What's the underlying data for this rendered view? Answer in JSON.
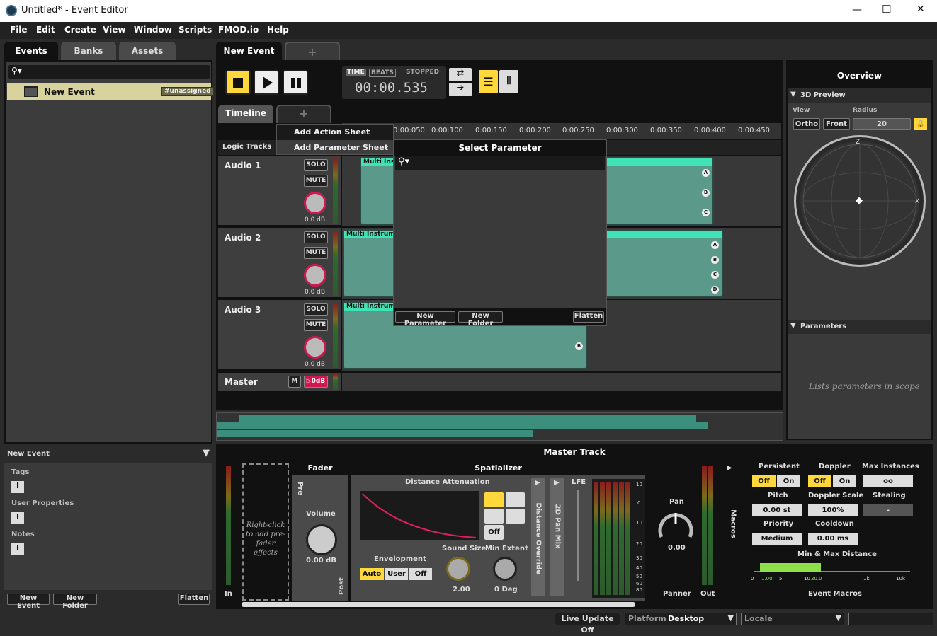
{
  "window": {
    "title": "Untitled* - Event Editor",
    "minimize": "—",
    "maximize": "☐",
    "close": "✕"
  },
  "menu": [
    "File",
    "Edit",
    "Create",
    "View",
    "Window",
    "Scripts",
    "FMOD.io",
    "Help"
  ],
  "browser": {
    "tabs": [
      "Events",
      "Banks",
      "Assets"
    ],
    "items": [
      {
        "label": "New Event",
        "tag": "#unassigned"
      }
    ],
    "footer": {
      "new_event": "New Event",
      "new_folder": "New Folder",
      "flatten": "Flatten"
    },
    "details": {
      "title": "New Event",
      "tags": "Tags",
      "user_properties": "User Properties",
      "notes": "Notes"
    }
  },
  "editor": {
    "event_tab": "New Event",
    "add_tab": "+",
    "transport": {
      "time_label": "TIME",
      "beats_label": "BEATS",
      "state": "STOPPED",
      "time": "00:00.535"
    },
    "timeline_tab": "Timeline",
    "logic_tracks": "Logic Tracks",
    "ruler": [
      "0:00:050",
      "0:00:100",
      "0:00:150",
      "0:00:200",
      "0:00:250",
      "0:00:300",
      "0:00:350",
      "0:00:400",
      "0:00:450"
    ],
    "tracks": [
      {
        "name": "Audio 1",
        "solo": "SOLO",
        "mute": "MUTE",
        "db": "0.0 dB",
        "region": "Multi Ins",
        "markers": [
          "A",
          "B",
          "C"
        ]
      },
      {
        "name": "Audio 2",
        "solo": "SOLO",
        "mute": "MUTE",
        "db": "0.0 dB",
        "region": "Multi Instrum",
        "markers": [
          "A",
          "B",
          "C",
          "D"
        ]
      },
      {
        "name": "Audio 3",
        "solo": "SOLO",
        "mute": "MUTE",
        "db": "0.0 dB",
        "region": "Multi Instrum",
        "markers": [
          "B"
        ]
      }
    ],
    "master": {
      "name": "Master",
      "m": "M",
      "db": "0dB"
    }
  },
  "context_menu": {
    "items": [
      "Add Action Sheet",
      "Add Parameter Sheet"
    ],
    "submenu_arrow": "›"
  },
  "select_parameter": {
    "title": "Select Parameter",
    "new_parameter": "New Parameter",
    "new_folder": "New Folder",
    "flatten": "Flatten"
  },
  "overview": {
    "title": "Overview",
    "preview_section": "3D Preview",
    "view_label": "View",
    "radius_label": "Radius",
    "ortho": "Ortho",
    "front": "Front",
    "radius": "20",
    "axis_z": "Z",
    "axis_x": "X",
    "parameters_section": "Parameters",
    "empty_text": "Lists parameters in scope"
  },
  "deck": {
    "title": "Master Track",
    "in": "In",
    "out": "Out",
    "prefader_hint": "Right-click to add pre-fader effects",
    "fader": {
      "title": "Fader",
      "pre": "Pre",
      "post": "Post",
      "volume": "Volume",
      "value": "0.00 dB"
    },
    "spatializer": {
      "title": "Spatializer",
      "distance_attenuation": "Distance Attenuation",
      "off": "Off",
      "envelopment": "Envelopment",
      "env_options": [
        "Auto",
        "User",
        "Off"
      ],
      "sound_size": "Sound Size",
      "sound_size_value": "2.00",
      "min_extent": "Min Extent",
      "min_extent_value": "0 Deg",
      "distance_override": "Distance Override",
      "pan_mix": "2D Pan Mix",
      "lfe": "LFE",
      "meter_scale": [
        "10",
        "0",
        "10",
        "20",
        "30",
        "40",
        "50",
        "60",
        "80"
      ]
    },
    "panner": {
      "title": "Panner",
      "pan": "Pan",
      "value": "0.00"
    },
    "macros": {
      "label": "Macros",
      "title": "Event Macros",
      "persistent": "Persistent",
      "doppler": "Doppler",
      "max_instances": "Max Instances",
      "off": "Off",
      "on": "On",
      "max_value": "oo",
      "pitch": "Pitch",
      "pitch_value": "0.00 st",
      "doppler_scale": "Doppler Scale",
      "doppler_scale_value": "100%",
      "stealing": "Stealing",
      "stealing_value": "-",
      "priority": "Priority",
      "priority_value": "Medium",
      "cooldown": "Cooldown",
      "cooldown_value": "0.00 ms",
      "min_max": "Min & Max Distance",
      "scale": [
        "0",
        "1.00",
        "5",
        "10",
        "20.0",
        "1k",
        "10k"
      ]
    }
  },
  "statusbar": {
    "live_update": "Live Update Off",
    "platform_label": "Platform",
    "platform": "Desktop",
    "locale_label": "Locale"
  }
}
